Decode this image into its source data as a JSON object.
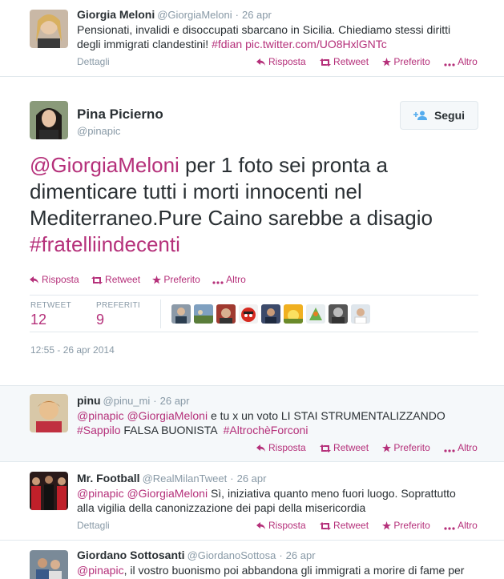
{
  "tweet1": {
    "name": "Giorgia Meloni",
    "handle": "@GiorgiaMeloni",
    "time": "26 apr",
    "text_line1": "Pensionati, invalidi e disoccupati sbarcano in Sicilia. Chiediamo stessi diritti",
    "text_line2_plain": "degli immigrati clandestini! ",
    "text_line2_hashtag": "#fdian",
    "text_line2_link": " pic.twitter.com/UO8HxlGNTc",
    "details": "Dettagli",
    "reply": "Risposta",
    "retweet": "Retweet",
    "favorite": "Preferito",
    "more": "Altro"
  },
  "main": {
    "name": "Pina Picierno",
    "handle": "@pinapic",
    "follow": "Segui",
    "mention": "@GiorgiaMeloni",
    "text_rest1": " per 1 foto sei pronta a",
    "text_line2": "dimenticare tutti i morti innocenti nel",
    "text_line3": "Mediterraneo.Pure Caino sarebbe a disagio",
    "hashtag": "#fratelliindecenti",
    "reply": "Risposta",
    "retweet": "Retweet",
    "favorite": "Preferito",
    "more": "Altro",
    "retweets_label": "RETWEET",
    "retweets_count": "12",
    "favorites_label": "PREFERITI",
    "favorites_count": "9",
    "timestamp": "12:55 - 26 apr 2014"
  },
  "reply1": {
    "name": "pinu",
    "handle": "@pinu_mi",
    "time": "26 apr",
    "m1": "@pinapic",
    "m2": "@GiorgiaMeloni",
    "rest1": " e tu x un voto LI STAI STRUMENTALIZZANDO",
    "h1": "#Sappilo",
    "mid2": " FALSA BUONISTA  ",
    "h2": "#AltrochèForconi",
    "reply": "Risposta",
    "retweet": "Retweet",
    "favorite": "Preferito",
    "more": "Altro"
  },
  "reply2": {
    "name": "Mr. Football",
    "handle": "@RealMilanTweet",
    "time": "26 apr",
    "m1": "@pinapic",
    "m2": "@GiorgiaMeloni",
    "rest1": " Sì, iniziativa quanto meno fuori luogo. Soprattutto",
    "line2": "alla vigilia della canonizzazione dei papi della misericordia",
    "details": "Dettagli",
    "reply": "Risposta",
    "retweet": "Retweet",
    "favorite": "Preferito",
    "more": "Altro"
  },
  "reply3": {
    "name": "Giordano Sottosanti",
    "handle": "@GiordanoSottosa",
    "time": "26 apr",
    "m1": "@pinapic",
    "rest1": ", il vostro buonismo poi abbandona gli immigrati a morire di fame per"
  },
  "colors": {
    "accent": "#b5307a",
    "muted": "#8899a6",
    "text": "#292f33",
    "border": "#e1e8ed"
  }
}
